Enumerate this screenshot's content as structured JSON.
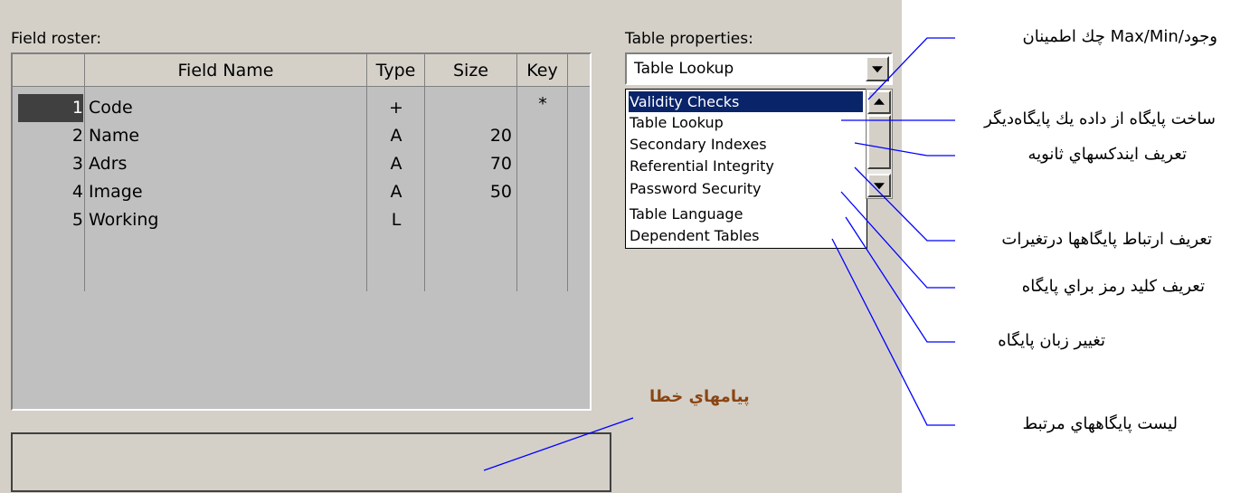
{
  "field_roster": {
    "label": "Field roster:",
    "columns": [
      "Field Name",
      "Type",
      "Size",
      "Key"
    ],
    "rows": [
      {
        "num": "1",
        "name": "Code",
        "type": "+",
        "size": "",
        "key": "*"
      },
      {
        "num": "2",
        "name": "Name",
        "type": "A",
        "size": "20",
        "key": ""
      },
      {
        "num": "3",
        "name": "Adrs",
        "type": "A",
        "size": "70",
        "key": ""
      },
      {
        "num": "4",
        "name": "Image",
        "type": "A",
        "size": "50",
        "key": ""
      },
      {
        "num": "5",
        "name": "Working",
        "type": "L",
        "size": "",
        "key": ""
      }
    ]
  },
  "table_properties": {
    "label": "Table properties:",
    "selected": "Table Lookup",
    "options": [
      "Validity Checks",
      "Table Lookup",
      "Secondary Indexes",
      "Referential Integrity",
      "Password Security",
      "Table Language",
      "Dependent Tables"
    ],
    "highlighted_index": 0
  },
  "annotations": [
    "وجود/Max/Min چك اطمينان",
    "ساخت پايگاه از داده يك پايگاه‌ديگر",
    "تعريف ايندكسهاي ثانويه",
    "تعريف ارتباط پايگاهها درتغيرات",
    "تعريف كليد رمز براي پايگاه",
    "تغيير زبان پايگاه",
    "ليست پايگاههاي مرتبط"
  ],
  "error_messages_label": "پيامهاي خطا",
  "colors": {
    "panel": "#d4d0c8",
    "grid": "#c0c0c0",
    "selection": "#0a246a",
    "line": "#0000ff",
    "error_label": "#8b4513"
  }
}
